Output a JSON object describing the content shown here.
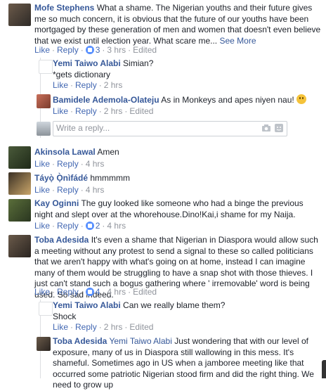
{
  "actions": {
    "like": "Like",
    "reply": "Reply",
    "edited": "Edited",
    "see_more": "See More"
  },
  "comments": [
    {
      "author": "Mofe Stephens",
      "text": "What a shame. The Nigerian youths and their future gives me so much concern, it is obvious that the future of our youths have been mortgaged by these generation of men and women that doesn't even believe that we exist until election year. What scare me...",
      "reaction_count": "3",
      "time": "3 hrs",
      "edited": true,
      "replies": [
        {
          "author": "Yemi Taiwo Alabi",
          "text": "Simian?",
          "text2": "*gets dictionary",
          "time": "2 hrs"
        },
        {
          "author": "Bamidele Ademola-Olateju",
          "text": "As in Monkeys and apes niyen nau!",
          "time": "2 hrs",
          "edited": true
        }
      ],
      "reply_box": {
        "placeholder": "Write a reply..."
      }
    },
    {
      "author": "Akinsola Lawal",
      "text": "Amen",
      "time": "4 hrs"
    },
    {
      "author": "Táyọ̀ Ọ̀nìfádé",
      "text": "hmmmmm",
      "time": "4 hrs"
    },
    {
      "author": "Kay Oginni",
      "text": "The guy looked like someone who had a binge the previous night and slept over at the whorehouse.Dino!Kai,i shame for my Naija.",
      "reaction_count": "2",
      "time": "4 hrs"
    },
    {
      "author": "Toba Adesida",
      "text": "It's even a shame that Nigerian in Diaspora would allow such a meeting without any protest to send a signal to these so called politicians that we aren't happy with what's going on at home, instead I can imagine many of them would be struggling to have a snap shot with those thieves. I just can't stand such a bogus gathering where ' irremovable' word is being used. So sad indeed.",
      "reaction_count": "4",
      "time": "4 hrs",
      "edited": true,
      "replies": [
        {
          "author": "Yemi Taiwo Alabi",
          "text": "Can we really blame them?",
          "text2": "Shock",
          "time": "2 hrs",
          "edited": true
        },
        {
          "author": "Toba Adesida",
          "mention": "Yemi Taiwo Alabi",
          "text": "Just wondering that with our level of exposure, many of us in Diaspora still wallowing in this mess. It's shameful. Sometimes ago in US when a jamboree meeting like that occurred some patriotic Nigerian stood firm and did the right thing. We need to grow up"
        }
      ]
    }
  ]
}
